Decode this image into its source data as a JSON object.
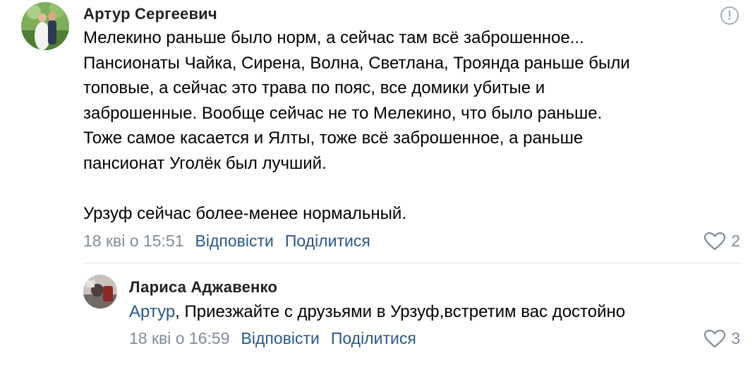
{
  "comments": [
    {
      "author": "Артур Сергеевич",
      "text": "Мелекино раньше было норм, а сейчас там всё заброшенное...\nПансионаты Чайка, Сирена, Волна, Светлана, Троянда раньше были\nтоповые, а сейчас это трава по пояс, все домики убитые и\nзаброшенные. Вообще сейчас не то Мелекино, что было раньше.\nТоже самое касается и Ялты, тоже всё заброшенное, а раньше\nпансионат Уголёк был лучший.\n\nУрзуф сейчас более-менее нормальный.",
      "timestamp": "18 кві о 15:51",
      "reply_label": "Відповісти",
      "share_label": "Поділитися",
      "likes": "2"
    }
  ],
  "reply": {
    "author": "Лариса Аджавенко",
    "mention": "Артур",
    "text": ", Приезжайте с друзьями в Урзуф,встретим вас достойно",
    "timestamp": "18 кві о 16:59",
    "reply_label": "Відповісти",
    "share_label": "Поділитися",
    "likes": "3"
  },
  "icons": {
    "report": "report-icon",
    "like": "heart-icon"
  }
}
